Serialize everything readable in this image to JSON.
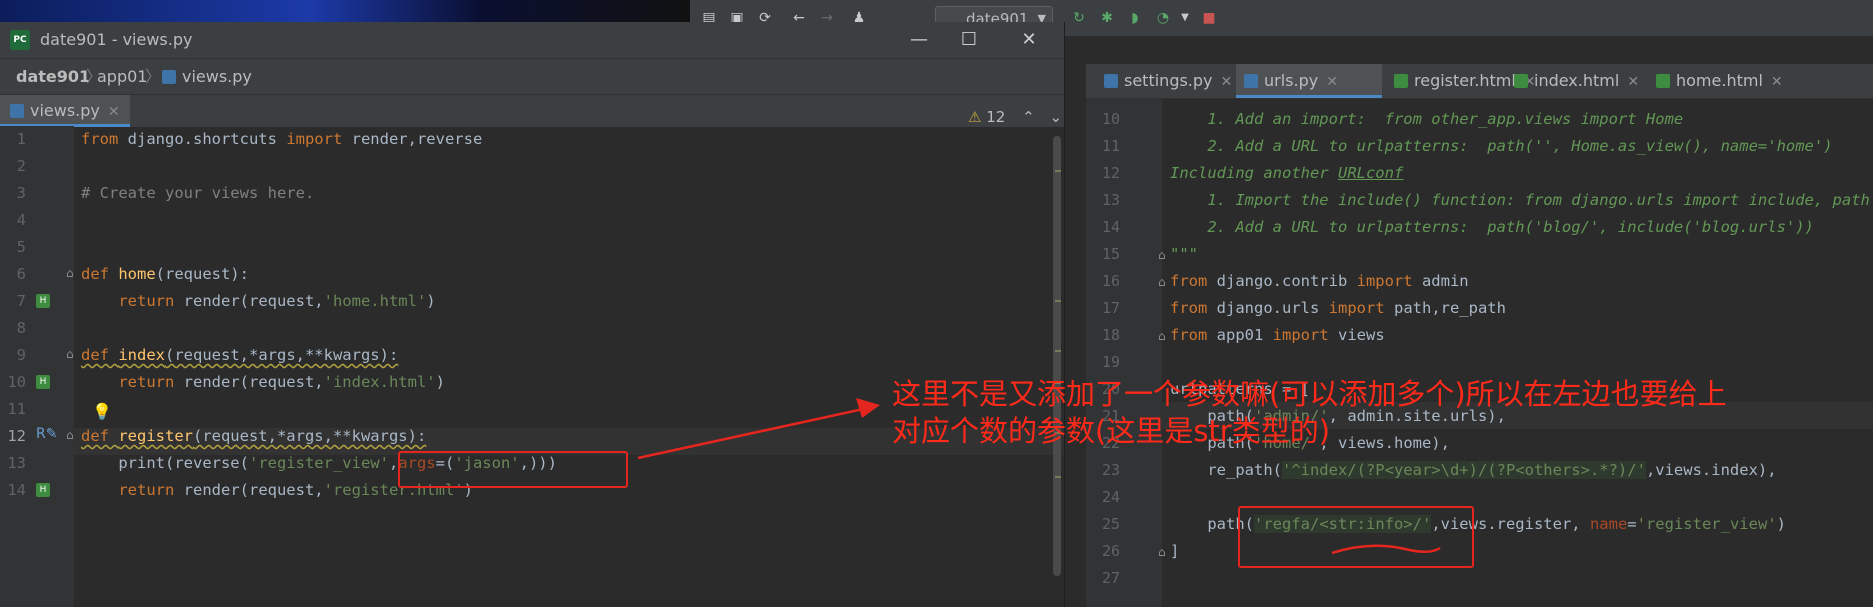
{
  "window": {
    "title": "date901 - views.py",
    "logo": "PC",
    "minimize": "—",
    "maximize": "☐",
    "close": "✕"
  },
  "breadcrumb": {
    "project": "date901",
    "folder": "app01",
    "file": "views.py"
  },
  "left_tab": {
    "label": "views.py",
    "close": "✕"
  },
  "inspection": {
    "count": "12"
  },
  "run_config": {
    "label": "date901"
  },
  "right_tabs": [
    {
      "label": "settings.py",
      "close": "✕"
    },
    {
      "label": "urls.py",
      "close": "✕"
    },
    {
      "label": "register.html",
      "close": "✕"
    },
    {
      "label": "index.html",
      "close": "✕"
    },
    {
      "label": "home.html",
      "close": "✕"
    }
  ],
  "left_line_numbers": [
    "1",
    "2",
    "3",
    "4",
    "5",
    "6",
    "7",
    "8",
    "9",
    "10",
    "11",
    "12",
    "13",
    "14"
  ],
  "left_code": {
    "l1_kw1": "from",
    "l1_mod": " django.shortcuts ",
    "l1_kw2": "import",
    "l1_rest": " render,reverse",
    "l3": "# Create your views here.",
    "l6_kw": "def ",
    "l6_fn": "home",
    "l6_rest": "(request):",
    "l7_kw": "    return",
    "l7_a": " render(request,",
    "l7_str": "'home.html'",
    "l7_b": ")",
    "l9_kw": "def ",
    "l9_fn": "index",
    "l9_rest": "(request,*args,**kwargs):",
    "l10_kw": "    return",
    "l10_a": " render(request,",
    "l10_str": "'index.html'",
    "l10_b": ")",
    "l12_kw": "def ",
    "l12_fn": "register",
    "l12_rest": "(request,*args,**kwargs):",
    "l13_a": "    print(reverse(",
    "l13_str": "'register_view'",
    "l13_b": ",",
    "l13_param": "args",
    "l13_c": "=(",
    "l13_str2": "'jason'",
    "l13_d": ",)))",
    "l14_kw": "    return",
    "l14_a": " render(request,",
    "l14_str": "'register.html'",
    "l14_b": ")"
  },
  "right_line_numbers": [
    "10",
    "11",
    "12",
    "13",
    "14",
    "15",
    "16",
    "17",
    "18",
    "19",
    "20",
    "21",
    "22",
    "23",
    "24",
    "25",
    "26",
    "27"
  ],
  "right_code": {
    "r10": "    1. Add an import:  from other_app.views import Home",
    "r11": "    2. Add a URL to urlpatterns:  path('', Home.as_view(), name='home')",
    "r12_a": "Including another ",
    "r12_b": "URLconf",
    "r13": "    1. Import the include() function: from django.urls import include, path",
    "r14": "    2. Add a URL to urlpatterns:  path('blog/', include('blog.urls'))",
    "r15": "\"\"\"",
    "r16_kw": "from",
    "r16_a": " django.contrib ",
    "r16_kw2": "import",
    "r16_b": " admin",
    "r17_kw": "from",
    "r17_a": " django.urls ",
    "r17_kw2": "import",
    "r17_b": " path,re_path",
    "r18_kw": "from",
    "r18_a": " app01 ",
    "r18_kw2": "import",
    "r18_b": " views",
    "r20": "urlpatterns = [",
    "r21_a": "    path(",
    "r21_str": "'admin/'",
    "r21_b": ", admin.site.urls),",
    "r22_a": "    path(",
    "r22_str": "'home/'",
    "r22_b": ", views.home),",
    "r23_a": "    re_path(",
    "r23_str": "'^index/(?P<year>\\d+)/(?P<others>.*?)/'",
    "r23_b": ",views.index),",
    "r25_a": "    path(",
    "r25_str": "'regfa/<str:info>/'",
    "r25_b": ",views.register, ",
    "r25_kw": "name",
    "r25_c": "=",
    "r25_str2": "'register_view'",
    "r25_d": ")",
    "r26": "]"
  },
  "annotation": {
    "line1": "这里不是又添加了一个参数嘛(可以添加多个)所以在左边也要给上",
    "line2": "对应个数的参数(这里是str类型的)",
    "color": "#ff2a1a"
  }
}
